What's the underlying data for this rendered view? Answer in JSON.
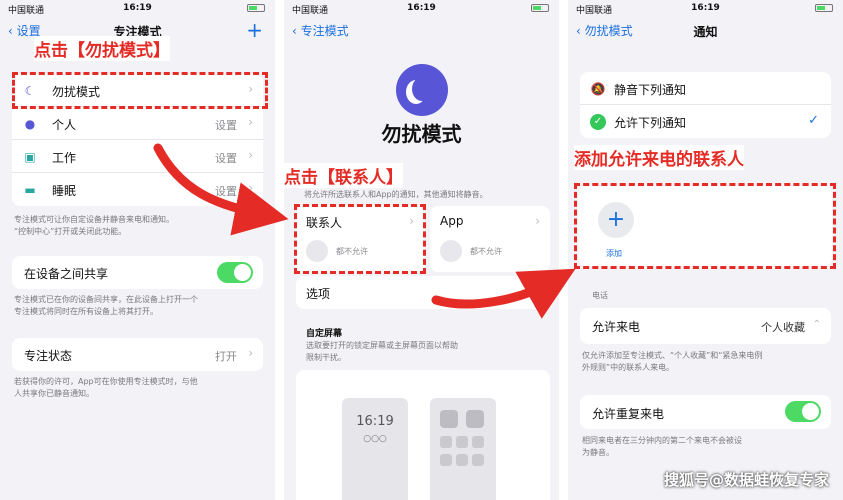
{
  "status": {
    "carrier": "中国联通",
    "time": "16:19"
  },
  "p1": {
    "back": "设置",
    "title": "专注模式",
    "callout": "点击【勿扰模式】",
    "modes": [
      {
        "label": "勿扰模式",
        "value": ""
      },
      {
        "label": "个人",
        "value": "设置"
      },
      {
        "label": "工作",
        "value": "设置"
      },
      {
        "label": "睡眠",
        "value": "设置"
      }
    ],
    "modes_footer": "专注模式可让你自定设备并静音来电和通知。\n“控制中心”打开或关闭此功能。",
    "share_label": "在设备之间共享",
    "share_footer": "专注模式已在你的设备间共享，在此设备上打开一个\n专注模式将同时在所有设备上将其打开。",
    "status_label": "专注状态",
    "status_value": "打开",
    "status_footer": "若获得你的许可，App可在你使用专注模式时，与他\n人共享你已静音通知。"
  },
  "p2": {
    "back": "专注模式",
    "title": "勿扰模式",
    "callout": "点击【联系人】",
    "hint": "将允许所选联系人和App的通知，其他通知将静音。",
    "contacts_label": "联系人",
    "contacts_value": "都不允许",
    "app_label": "App",
    "app_value": "都不允许",
    "options_label": "选项",
    "custom_title": "自定屏幕",
    "custom_desc": "选取要打开的锁定屏幕或主屏幕页面以帮助\n限制干扰。",
    "lock_time": "16:19"
  },
  "p3": {
    "back": "勿扰模式",
    "title": "通知",
    "silence_label": "静音下列通知",
    "allow_label": "允许下列通知",
    "callout": "添加允许来电的联系人",
    "add_label": "添加",
    "calls_section": "电话",
    "allow_calls_label": "允许来电",
    "allow_calls_value": "个人收藏",
    "allow_calls_footer": "仅允许添加至专注模式、“个人收藏”和“紧急来电例\n外规则”中的联系人来电。",
    "repeat_label": "允许重复来电",
    "repeat_footer": "相同来电者在三分钟内的第二个来电不会被设\n为静音。"
  },
  "watermark": "搜狐号@数据蛙恢复专家",
  "colors": {
    "accent": "#1a6fe0",
    "annotation": "#e42b25",
    "toggle_on": "#4cd964",
    "dnd_moon": "#5856d6"
  }
}
